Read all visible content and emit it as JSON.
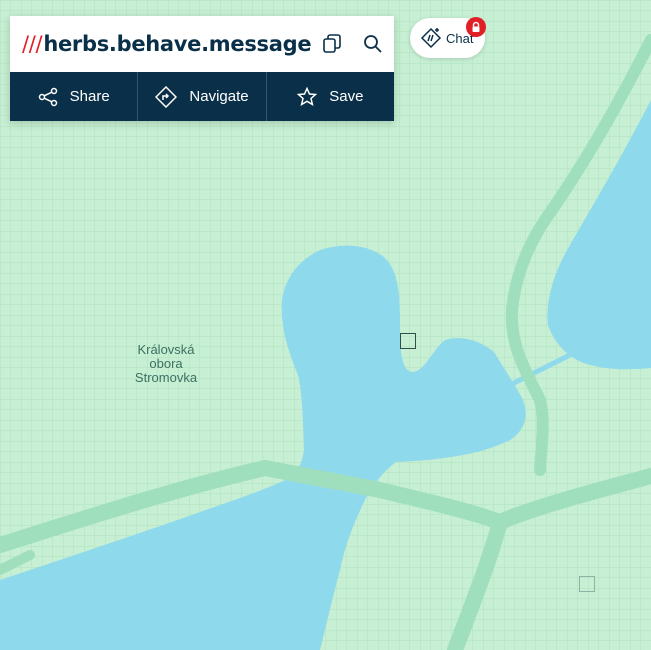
{
  "address": {
    "prefix": "///",
    "words": "herbs.behave.message"
  },
  "icons": {
    "copy": "copy-icon",
    "search": "search-icon",
    "share": "share-icon",
    "navigate": "navigate-icon",
    "save": "star-icon",
    "chat": "chat-icon",
    "lock": "lock-icon"
  },
  "actions": {
    "share": "Share",
    "navigate": "Navigate",
    "save": "Save"
  },
  "chat": {
    "label": "Chat"
  },
  "map": {
    "poi_lines": [
      "Královská",
      "obora",
      "Stromovka"
    ],
    "colors": {
      "land": "#c6efd3",
      "grid": "#b4e3c3",
      "water": "#8fd9ec",
      "road": "#9fdfbd",
      "brand": "#0a3049",
      "accent": "#e11f26"
    }
  }
}
